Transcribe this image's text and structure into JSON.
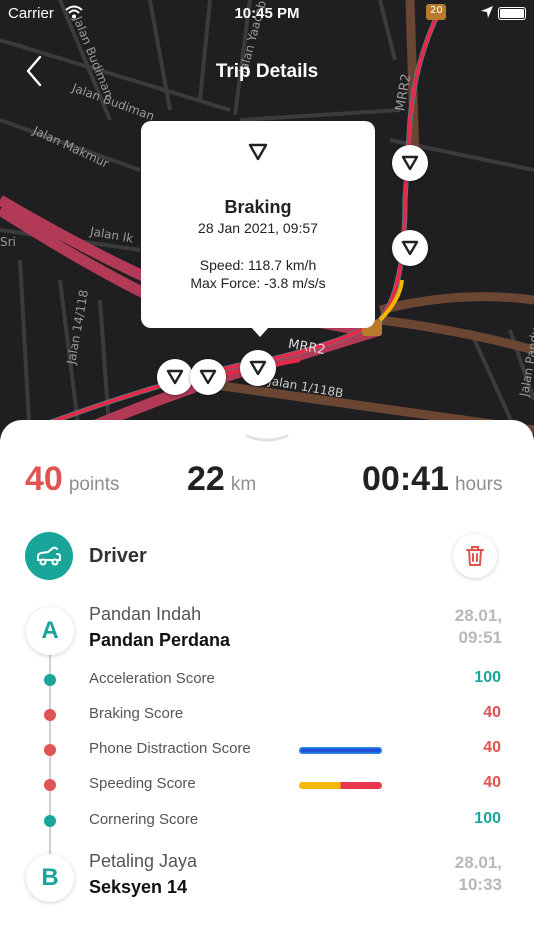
{
  "status_bar": {
    "carrier": "Carrier",
    "time": "10:45 PM"
  },
  "nav": {
    "title": "Trip Details"
  },
  "map": {
    "labels": [
      "Jalan Budiman",
      "Jalan Budiman",
      "Jalan Makmur",
      "Jalan Ik",
      "MRR2",
      "MRR2",
      "Jalan 1/118B",
      "Jalan 14/118",
      "Sri",
      "Jalan Yaacob",
      "Jalan Pandu",
      "20"
    ]
  },
  "popup": {
    "event_icon": "braking-event-icon",
    "title": "Braking",
    "datetime": "28 Jan 2021, 09:57",
    "speed": "Speed: 118.7 km/h",
    "max_force": "Max Force: -3.8 m/s/s"
  },
  "stats": {
    "points_value": "40",
    "points_unit": "points",
    "distance_value": "22",
    "distance_unit": "km",
    "duration_value": "00:41",
    "duration_unit": "hours"
  },
  "driver": {
    "label": "Driver",
    "icon": "car-driver-icon"
  },
  "start": {
    "letter": "A",
    "area": "Pandan Indah",
    "place": "Pandan Perdana",
    "time_line1": "28.01,",
    "time_line2": "09:51"
  },
  "end": {
    "letter": "B",
    "area": "Petaling Jaya",
    "place": "Seksyen 14",
    "time_line1": "28.01,",
    "time_line2": "10:33"
  },
  "scores": [
    {
      "label": "Acceleration Score",
      "value": "100",
      "color": "#1aa59a",
      "bar": null
    },
    {
      "label": "Braking Score",
      "value": "40",
      "color": "#e05353",
      "bar": null
    },
    {
      "label": "Phone Distraction Score",
      "value": "40",
      "color": "#e05353",
      "bar": [
        "#1e4fd6",
        "#1e4fd6"
      ]
    },
    {
      "label": "Speeding Score",
      "value": "40",
      "color": "#e05353",
      "bar": [
        "#f5b800",
        "#e8384f"
      ]
    },
    {
      "label": "Cornering Score",
      "value": "100",
      "color": "#1aa59a",
      "bar": null
    }
  ],
  "colors": {
    "accent": "#1aa59a",
    "points": "#e05353",
    "danger": "#e05353"
  }
}
